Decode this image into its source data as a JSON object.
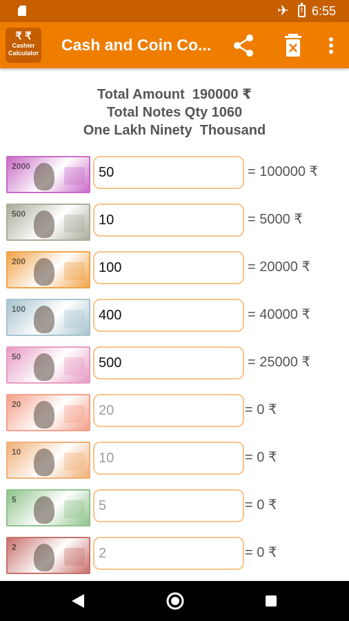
{
  "status_bar": {
    "time": "6:55",
    "battery_glyph": "!",
    "icons": [
      "sd-card-icon",
      "airplane-icon",
      "battery-alert-icon"
    ]
  },
  "app_bar": {
    "icon_symbol": "₹ ₹",
    "icon_line1": "Cashier",
    "icon_line2": "Calculator",
    "title": "Cash and Coin Co...",
    "actions": [
      "share-icon",
      "delete-icon",
      "more-vert-icon"
    ],
    "colors": {
      "app_bar": "#ef7d00",
      "status_bar": "#c75f00",
      "field_border": "#f7c488"
    }
  },
  "summary": {
    "total_amount": "Total Amount  190000 ₹",
    "total_qty": "Total Notes Qty 1060",
    "in_words": "One Lakh Ninety  Thousand"
  },
  "rows": [
    {
      "denomination": "2000",
      "value": "50",
      "placeholder": "",
      "total": "= 100000 ₹",
      "note_color": "#c96bc7"
    },
    {
      "denomination": "500",
      "value": "10",
      "placeholder": "",
      "total": "= 5000 ₹",
      "note_color": "#a9ad9a"
    },
    {
      "denomination": "200",
      "value": "100",
      "placeholder": "",
      "total": "= 20000 ₹",
      "note_color": "#f1a34a"
    },
    {
      "denomination": "100",
      "value": "400",
      "placeholder": "",
      "total": "= 40000 ₹",
      "note_color": "#a8c3cf"
    },
    {
      "denomination": "50",
      "value": "500",
      "placeholder": "",
      "total": "= 25000 ₹",
      "note_color": "#e79bc2"
    },
    {
      "denomination": "20",
      "value": "",
      "placeholder": "20",
      "total": "= 0 ₹",
      "note_color": "#f4a08a"
    },
    {
      "denomination": "10",
      "value": "",
      "placeholder": "10",
      "total": "= 0 ₹",
      "note_color": "#f0b078"
    },
    {
      "denomination": "5",
      "value": "",
      "placeholder": "5",
      "total": "= 0 ₹",
      "note_color": "#8fc38b"
    },
    {
      "denomination": "2",
      "value": "",
      "placeholder": "2",
      "total": "= 0 ₹",
      "note_color": "#c7716b"
    }
  ],
  "nav_bar": {
    "icons": [
      "back-icon",
      "home-icon",
      "recents-icon"
    ]
  }
}
